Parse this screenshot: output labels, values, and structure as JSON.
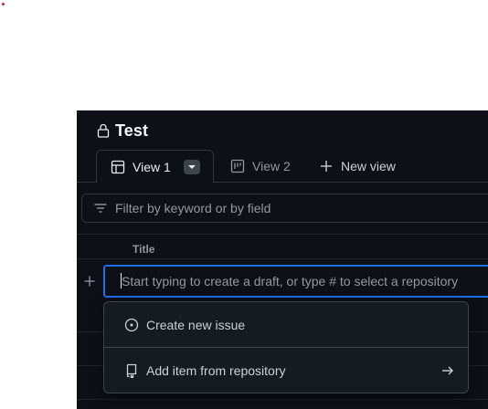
{
  "project": {
    "title": "Test"
  },
  "tabs": [
    {
      "label": "View 1",
      "active": true
    },
    {
      "label": "View 2",
      "active": false
    }
  ],
  "new_view_label": "New view",
  "filter": {
    "placeholder": "Filter by keyword or by field"
  },
  "table": {
    "columns": [
      "Title"
    ]
  },
  "draft": {
    "placeholder": "Start typing to create a draft, or type # to select a repository"
  },
  "menu": {
    "items": [
      {
        "label": "Create new issue",
        "icon": "issue-opened-icon"
      },
      {
        "label": "Add item from repository",
        "icon": "repo-icon",
        "trailing_icon": "arrow-right-icon"
      }
    ]
  },
  "colors": {
    "background": "#0d1117",
    "border": "#30363d",
    "accent": "#1f6feb",
    "muted_text": "#9198a1",
    "text": "#e6edf3"
  }
}
